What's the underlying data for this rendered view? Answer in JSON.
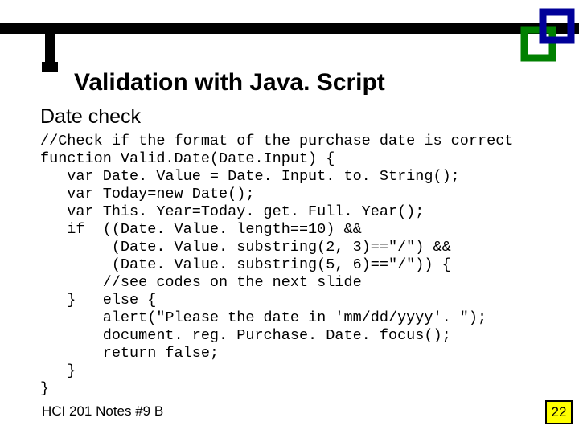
{
  "title": "Validation with Java. Script",
  "subtitle": "Date check",
  "code": "//Check if the format of the purchase date is correct\nfunction Valid.Date(Date.Input) {\n   var Date. Value = Date. Input. to. String();\n   var Today=new Date();\n   var This. Year=Today. get. Full. Year();\n   if  ((Date. Value. length==10) &&\n        (Date. Value. substring(2, 3)==\"/\") &&\n        (Date. Value. substring(5, 6)==\"/\")) {\n       //see codes on the next slide\n   }   else {\n       alert(\"Please the date in 'mm/dd/yyyy'. \");\n       document. reg. Purchase. Date. focus();\n       return false;\n   }\n}",
  "footer_left": "HCI 201 Notes #9 B",
  "footer_right": "22"
}
